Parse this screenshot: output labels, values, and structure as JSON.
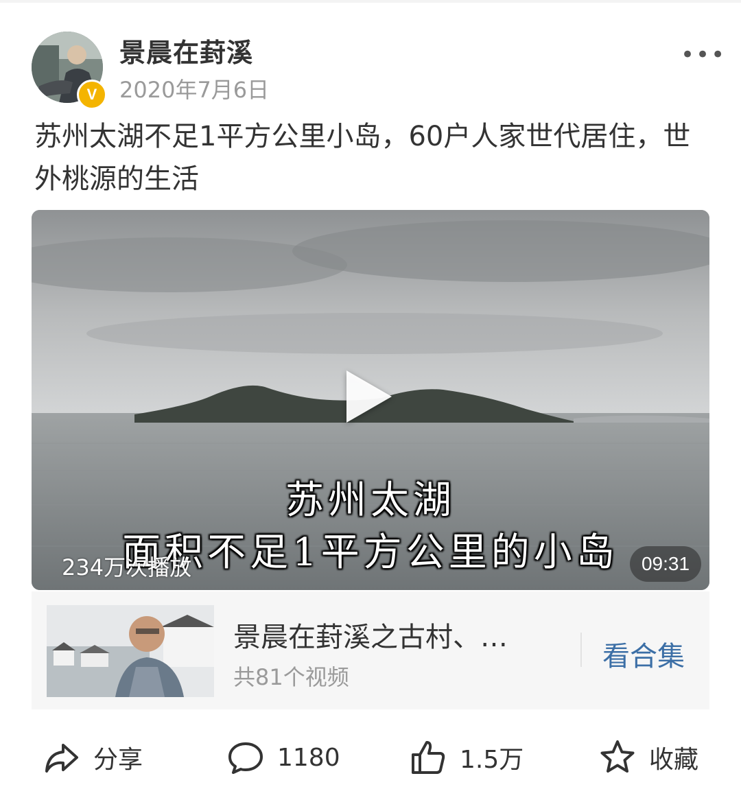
{
  "author": {
    "name": "景晨在葑溪",
    "verified_badge": "V",
    "date": "2020年7月6日"
  },
  "more_icon": "more-dots-icon",
  "post": {
    "text": "苏州太湖不足1平方公里小岛，60户人家世代居住，世外桃源的生活"
  },
  "video": {
    "caption_line1": "苏州太湖",
    "caption_line2": "面积不足1平方公里的小岛",
    "views": "234万次播放",
    "duration": "09:31",
    "play_icon": "play-icon"
  },
  "collection": {
    "title": "景晨在葑溪之古村、…",
    "count": "共81个视频",
    "button": "看合集"
  },
  "actions": {
    "share": {
      "label": "分享",
      "icon": "share-icon"
    },
    "comment": {
      "label": "1180",
      "icon": "comment-icon"
    },
    "like": {
      "label": "1.5万",
      "icon": "thumbs-up-icon"
    },
    "favorite": {
      "label": "收藏",
      "icon": "star-icon"
    }
  },
  "colors": {
    "link": "#3c6fa6",
    "badge": "#f4b400",
    "muted": "#9a9a9a"
  }
}
